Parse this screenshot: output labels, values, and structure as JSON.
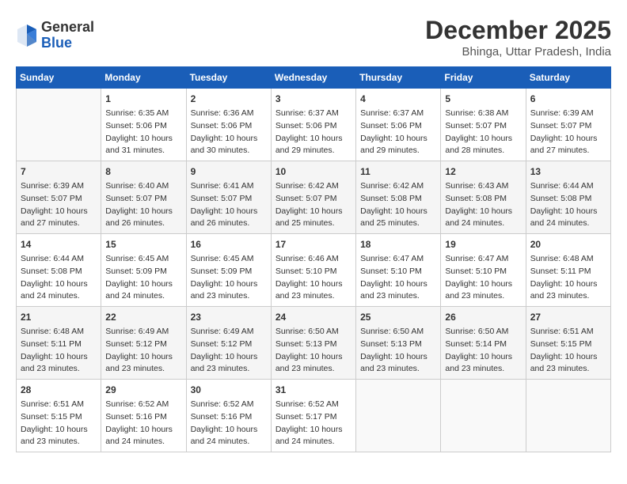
{
  "header": {
    "logo_general": "General",
    "logo_blue": "Blue",
    "month_title": "December 2025",
    "location": "Bhinga, Uttar Pradesh, India"
  },
  "weekdays": [
    "Sunday",
    "Monday",
    "Tuesday",
    "Wednesday",
    "Thursday",
    "Friday",
    "Saturday"
  ],
  "weeks": [
    [
      {
        "day": "",
        "sunrise": "",
        "sunset": "",
        "daylight": ""
      },
      {
        "day": "1",
        "sunrise": "Sunrise: 6:35 AM",
        "sunset": "Sunset: 5:06 PM",
        "daylight": "Daylight: 10 hours and 31 minutes."
      },
      {
        "day": "2",
        "sunrise": "Sunrise: 6:36 AM",
        "sunset": "Sunset: 5:06 PM",
        "daylight": "Daylight: 10 hours and 30 minutes."
      },
      {
        "day": "3",
        "sunrise": "Sunrise: 6:37 AM",
        "sunset": "Sunset: 5:06 PM",
        "daylight": "Daylight: 10 hours and 29 minutes."
      },
      {
        "day": "4",
        "sunrise": "Sunrise: 6:37 AM",
        "sunset": "Sunset: 5:06 PM",
        "daylight": "Daylight: 10 hours and 29 minutes."
      },
      {
        "day": "5",
        "sunrise": "Sunrise: 6:38 AM",
        "sunset": "Sunset: 5:07 PM",
        "daylight": "Daylight: 10 hours and 28 minutes."
      },
      {
        "day": "6",
        "sunrise": "Sunrise: 6:39 AM",
        "sunset": "Sunset: 5:07 PM",
        "daylight": "Daylight: 10 hours and 27 minutes."
      }
    ],
    [
      {
        "day": "7",
        "sunrise": "Sunrise: 6:39 AM",
        "sunset": "Sunset: 5:07 PM",
        "daylight": "Daylight: 10 hours and 27 minutes."
      },
      {
        "day": "8",
        "sunrise": "Sunrise: 6:40 AM",
        "sunset": "Sunset: 5:07 PM",
        "daylight": "Daylight: 10 hours and 26 minutes."
      },
      {
        "day": "9",
        "sunrise": "Sunrise: 6:41 AM",
        "sunset": "Sunset: 5:07 PM",
        "daylight": "Daylight: 10 hours and 26 minutes."
      },
      {
        "day": "10",
        "sunrise": "Sunrise: 6:42 AM",
        "sunset": "Sunset: 5:07 PM",
        "daylight": "Daylight: 10 hours and 25 minutes."
      },
      {
        "day": "11",
        "sunrise": "Sunrise: 6:42 AM",
        "sunset": "Sunset: 5:08 PM",
        "daylight": "Daylight: 10 hours and 25 minutes."
      },
      {
        "day": "12",
        "sunrise": "Sunrise: 6:43 AM",
        "sunset": "Sunset: 5:08 PM",
        "daylight": "Daylight: 10 hours and 24 minutes."
      },
      {
        "day": "13",
        "sunrise": "Sunrise: 6:44 AM",
        "sunset": "Sunset: 5:08 PM",
        "daylight": "Daylight: 10 hours and 24 minutes."
      }
    ],
    [
      {
        "day": "14",
        "sunrise": "Sunrise: 6:44 AM",
        "sunset": "Sunset: 5:08 PM",
        "daylight": "Daylight: 10 hours and 24 minutes."
      },
      {
        "day": "15",
        "sunrise": "Sunrise: 6:45 AM",
        "sunset": "Sunset: 5:09 PM",
        "daylight": "Daylight: 10 hours and 24 minutes."
      },
      {
        "day": "16",
        "sunrise": "Sunrise: 6:45 AM",
        "sunset": "Sunset: 5:09 PM",
        "daylight": "Daylight: 10 hours and 23 minutes."
      },
      {
        "day": "17",
        "sunrise": "Sunrise: 6:46 AM",
        "sunset": "Sunset: 5:10 PM",
        "daylight": "Daylight: 10 hours and 23 minutes."
      },
      {
        "day": "18",
        "sunrise": "Sunrise: 6:47 AM",
        "sunset": "Sunset: 5:10 PM",
        "daylight": "Daylight: 10 hours and 23 minutes."
      },
      {
        "day": "19",
        "sunrise": "Sunrise: 6:47 AM",
        "sunset": "Sunset: 5:10 PM",
        "daylight": "Daylight: 10 hours and 23 minutes."
      },
      {
        "day": "20",
        "sunrise": "Sunrise: 6:48 AM",
        "sunset": "Sunset: 5:11 PM",
        "daylight": "Daylight: 10 hours and 23 minutes."
      }
    ],
    [
      {
        "day": "21",
        "sunrise": "Sunrise: 6:48 AM",
        "sunset": "Sunset: 5:11 PM",
        "daylight": "Daylight: 10 hours and 23 minutes."
      },
      {
        "day": "22",
        "sunrise": "Sunrise: 6:49 AM",
        "sunset": "Sunset: 5:12 PM",
        "daylight": "Daylight: 10 hours and 23 minutes."
      },
      {
        "day": "23",
        "sunrise": "Sunrise: 6:49 AM",
        "sunset": "Sunset: 5:12 PM",
        "daylight": "Daylight: 10 hours and 23 minutes."
      },
      {
        "day": "24",
        "sunrise": "Sunrise: 6:50 AM",
        "sunset": "Sunset: 5:13 PM",
        "daylight": "Daylight: 10 hours and 23 minutes."
      },
      {
        "day": "25",
        "sunrise": "Sunrise: 6:50 AM",
        "sunset": "Sunset: 5:13 PM",
        "daylight": "Daylight: 10 hours and 23 minutes."
      },
      {
        "day": "26",
        "sunrise": "Sunrise: 6:50 AM",
        "sunset": "Sunset: 5:14 PM",
        "daylight": "Daylight: 10 hours and 23 minutes."
      },
      {
        "day": "27",
        "sunrise": "Sunrise: 6:51 AM",
        "sunset": "Sunset: 5:15 PM",
        "daylight": "Daylight: 10 hours and 23 minutes."
      }
    ],
    [
      {
        "day": "28",
        "sunrise": "Sunrise: 6:51 AM",
        "sunset": "Sunset: 5:15 PM",
        "daylight": "Daylight: 10 hours and 23 minutes."
      },
      {
        "day": "29",
        "sunrise": "Sunrise: 6:52 AM",
        "sunset": "Sunset: 5:16 PM",
        "daylight": "Daylight: 10 hours and 24 minutes."
      },
      {
        "day": "30",
        "sunrise": "Sunrise: 6:52 AM",
        "sunset": "Sunset: 5:16 PM",
        "daylight": "Daylight: 10 hours and 24 minutes."
      },
      {
        "day": "31",
        "sunrise": "Sunrise: 6:52 AM",
        "sunset": "Sunset: 5:17 PM",
        "daylight": "Daylight: 10 hours and 24 minutes."
      },
      {
        "day": "",
        "sunrise": "",
        "sunset": "",
        "daylight": ""
      },
      {
        "day": "",
        "sunrise": "",
        "sunset": "",
        "daylight": ""
      },
      {
        "day": "",
        "sunrise": "",
        "sunset": "",
        "daylight": ""
      }
    ]
  ]
}
